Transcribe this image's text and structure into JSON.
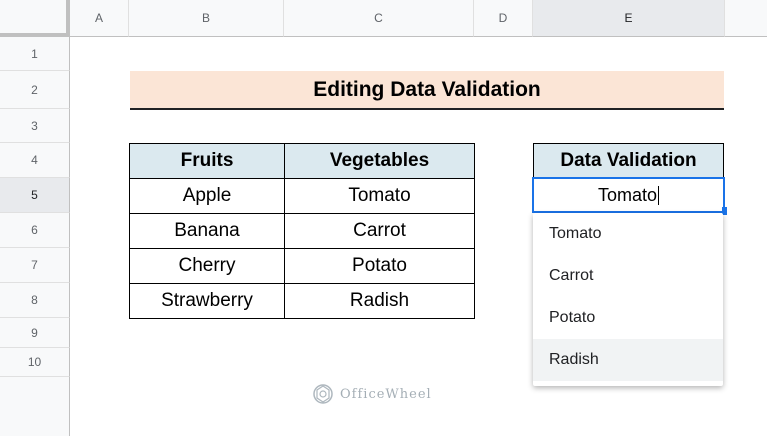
{
  "columns": [
    "A",
    "B",
    "C",
    "D",
    "E"
  ],
  "rows": [
    "1",
    "2",
    "3",
    "4",
    "5",
    "6",
    "7",
    "8",
    "9",
    "10"
  ],
  "title": "Editing Data Validation",
  "table": {
    "headers": [
      "Fruits",
      "Vegetables"
    ],
    "rows": [
      [
        "Apple",
        "Tomato"
      ],
      [
        "Banana",
        "Carrot"
      ],
      [
        "Cherry",
        "Potato"
      ],
      [
        "Strawberry",
        "Radish"
      ]
    ]
  },
  "data_validation": {
    "header": "Data Validation",
    "cell_value": "Tomato",
    "options": [
      "Tomato",
      "Carrot",
      "Potato",
      "Radish"
    ],
    "hovered_option": "Radish"
  },
  "watermark": "OfficeWheel",
  "colors": {
    "title_bg": "#fbe5d6",
    "header_bg": "#dbe9ef",
    "selection": "#1a73e8"
  }
}
